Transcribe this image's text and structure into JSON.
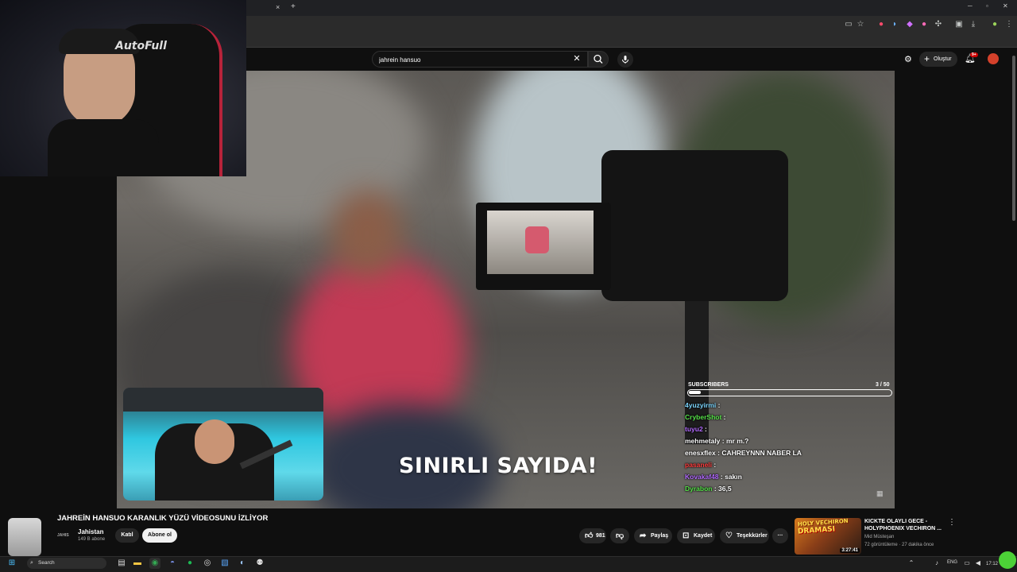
{
  "browser": {
    "tab_close": "×",
    "new_tab": "+",
    "window_controls": [
      "─",
      "▫",
      "✕"
    ],
    "extension_icons": [
      "cast-icon",
      "star-icon",
      "extension-icon",
      "profile-icon",
      "menu-icon"
    ]
  },
  "search": {
    "value": "jahrein hansuo",
    "clear": "✕",
    "button_icon": "search-icon",
    "mic_icon": "mic-icon"
  },
  "header": {
    "create_label": "Oluştur",
    "notification_badge": "9+"
  },
  "video": {
    "caption": "SINIRLI SAYIDA!"
  },
  "overlay": {
    "subs_label": "SUBSCRIBERS",
    "subs_count": "3  / 50",
    "subs_progress": 0.06,
    "chat": [
      {
        "user": "4yuzyirmi",
        "msg": ":",
        "color": "#7cd6ff"
      },
      {
        "user": "CryberShot",
        "msg": ":",
        "color": "#57e34a"
      },
      {
        "user": "tuyu2",
        "msg": ":",
        "color": "#b36bff"
      },
      {
        "user": "mehmetaly",
        "msg": ": mr m.?",
        "color": "#ffffff"
      },
      {
        "user": "enesxflex",
        "msg": ": CAHREYNNN NABER LA",
        "color": "#ffffff"
      },
      {
        "user": "pasaneli",
        "msg": ":",
        "color": "#ff3e3e"
      },
      {
        "user": "Kovakaf48",
        "msg": ": sakın",
        "color": "#b36bff"
      },
      {
        "user": "Dyrabon",
        "msg": ": 36,5",
        "color": "#57e34a"
      }
    ]
  },
  "below": {
    "title": "JAHREİN HANSUO KARANLIK YÜZÜ VİDEOSUNU İZLİYOR",
    "channel_name": "Jahistan",
    "channel_avatar": "JAHIS",
    "channel_subs": "149 B abone",
    "join_label": "Katıl",
    "subscribe_label": "Abone ol",
    "like_count": "981",
    "share_label": "Paylaş",
    "save_label": "Kaydet",
    "thanks_label": "Teşekkürler",
    "more": "···"
  },
  "recommended": {
    "tag_line1": "HOLY VECHIRON",
    "tag_line2": "DRAMASI",
    "duration": "3:27:41",
    "title": "KICKTE OLAYLI GECE - HOLYPHOENIX VECHIRON ...",
    "channel": "Mid Müsteşan",
    "meta": "72 görüntüleme · 27 dakika önce",
    "menu": "⋮"
  },
  "taskbar": {
    "search_placeholder": "Search",
    "language": "ENG",
    "time": "17:12"
  }
}
